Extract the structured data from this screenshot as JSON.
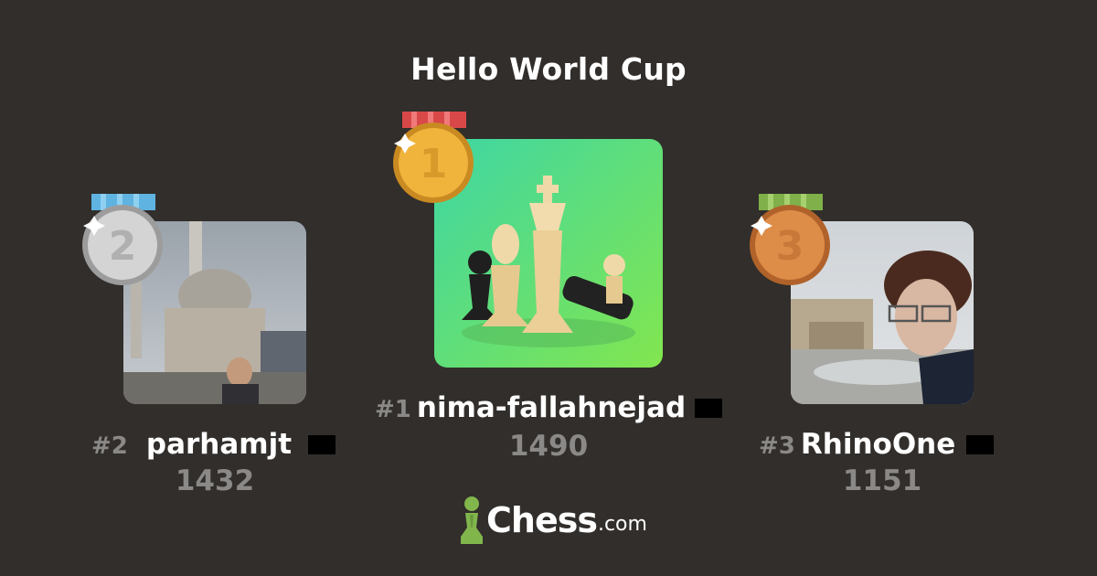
{
  "title": "Hello World Cup",
  "podium": [
    {
      "position": 1,
      "rank_label": "#1",
      "username": "nima-fallahnejad",
      "score": "1490",
      "medal_digit": "1",
      "medal_color": "#e8a93a",
      "ribbon_color": "#d94848"
    },
    {
      "position": 2,
      "rank_label": "#2",
      "username": "parhamjt",
      "score": "1432",
      "medal_digit": "2",
      "medal_color": "#c9c9c9",
      "ribbon_color": "#5fb3e0"
    },
    {
      "position": 3,
      "rank_label": "#3",
      "username": "RhinoOne",
      "score": "1151",
      "medal_digit": "3",
      "medal_color": "#d4823e",
      "ribbon_color": "#7fb04a"
    }
  ],
  "brand": {
    "name": "Chess",
    "suffix": ".com",
    "accent": "#81b64c"
  }
}
